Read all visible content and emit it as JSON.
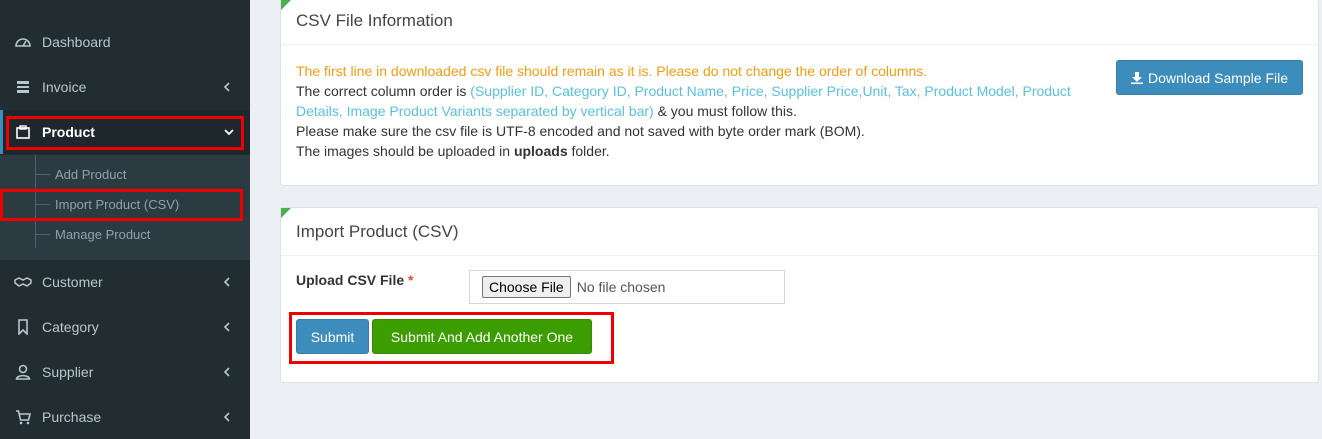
{
  "sidebar": {
    "items": [
      {
        "label": "Dashboard",
        "icon": "dashboard-icon"
      },
      {
        "label": "Invoice",
        "icon": "invoice-icon"
      },
      {
        "label": "Product",
        "icon": "product-icon"
      },
      {
        "label": "Customer",
        "icon": "handshake-icon"
      },
      {
        "label": "Category",
        "icon": "bookmark-icon"
      },
      {
        "label": "Supplier",
        "icon": "user-icon"
      },
      {
        "label": "Purchase",
        "icon": "cart-icon"
      }
    ],
    "product_submenu": [
      "Add Product",
      "Import Product (CSV)",
      "Manage Product"
    ]
  },
  "info_box": {
    "title": "CSV File Information",
    "warning": "The first line in downloaded csv file should remain as it is. Please do not change the order of columns.",
    "column_prefix": "The correct column order is ",
    "columns": "(Supplier ID, Category ID, Product Name, Price, Supplier Price,Unit, Tax, Product Model, Product Details, Image Product Variants separated by vertical bar)",
    "column_suffix": " & you must follow this.",
    "encoding_note": "Please make sure the csv file is UTF-8 encoded and not saved with byte order mark (BOM).",
    "images_prefix": "The images should be uploaded in ",
    "images_folder": "uploads",
    "images_suffix": " folder.",
    "download_label": "Download Sample File"
  },
  "import_box": {
    "title": "Import Product (CSV)",
    "upload_label": "Upload CSV File",
    "required_mark": "*",
    "choose_label": "Choose File",
    "file_status": "No file chosen",
    "submit_label": "Submit",
    "submit_add_label": "Submit And Add Another One"
  },
  "colors": {
    "sidebar_bg": "#222d32",
    "primary": "#3c8dbc",
    "success": "#3c9d00",
    "warning": "#f39c12",
    "info": "#5bc0de",
    "highlight": "#ee0000"
  }
}
